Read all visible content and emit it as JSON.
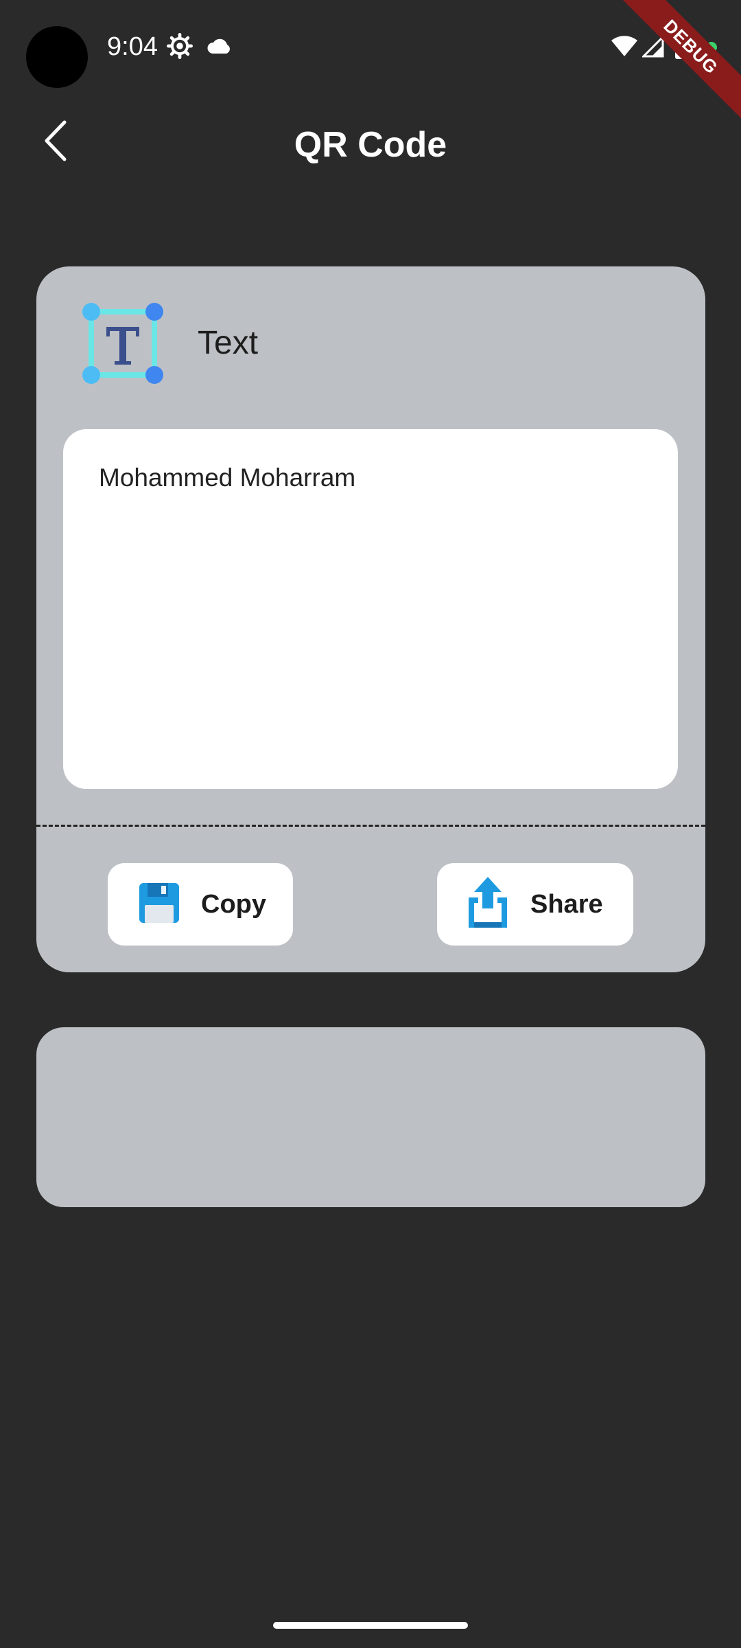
{
  "status_bar": {
    "time": "9:04",
    "icons": [
      "settings-gear-icon",
      "cloud-icon",
      "wifi-icon",
      "signal-icon",
      "battery-icon"
    ],
    "debug_banner": "DEBUG"
  },
  "app_bar": {
    "title": "QR Code",
    "back_icon": "chevron-left-icon"
  },
  "card": {
    "type_label": "Text",
    "type_icon": "text-type-icon",
    "content": "Mohammed Moharram",
    "actions": {
      "copy_label": "Copy",
      "copy_icon": "floppy-disk-icon",
      "share_label": "Share",
      "share_icon": "share-upload-icon"
    }
  },
  "colors": {
    "background": "#2a2a2a",
    "card": "#bdc1c5",
    "accent_blue": "#1e9be0",
    "debug_red": "#8b1c1c"
  }
}
